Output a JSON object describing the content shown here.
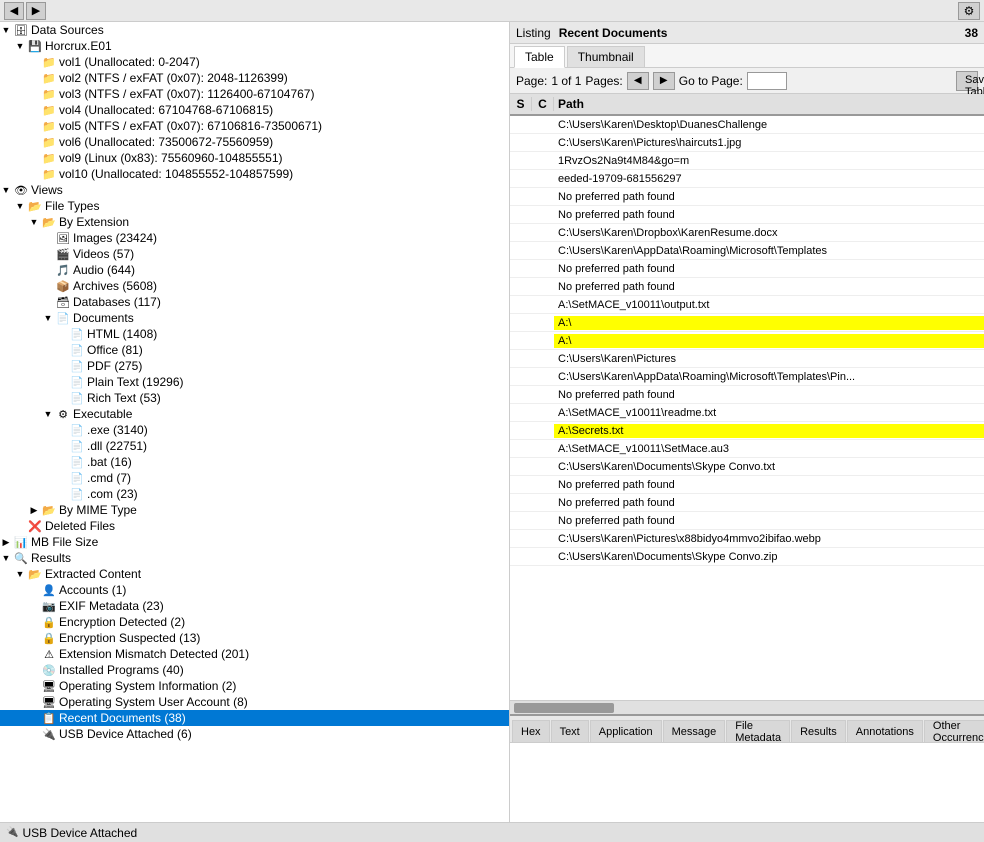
{
  "topBar": {
    "backLabel": "◀",
    "forwardLabel": "▶",
    "gearLabel": "⚙"
  },
  "leftPanel": {
    "tree": [
      {
        "id": "data-sources",
        "label": "Data Sources",
        "indent": 0,
        "expander": "▼",
        "icon": "🗄",
        "type": "root"
      },
      {
        "id": "horcrux",
        "label": "Horcrux.E01",
        "indent": 1,
        "expander": "▼",
        "icon": "💾",
        "type": "drive"
      },
      {
        "id": "vol1",
        "label": "vol1 (Unallocated: 0-2047)",
        "indent": 2,
        "expander": " ",
        "icon": "📁",
        "type": "vol"
      },
      {
        "id": "vol2",
        "label": "vol2 (NTFS / exFAT (0x07): 2048-1126399)",
        "indent": 2,
        "expander": " ",
        "icon": "📁",
        "type": "vol"
      },
      {
        "id": "vol3",
        "label": "vol3 (NTFS / exFAT (0x07): 1126400-67104767)",
        "indent": 2,
        "expander": " ",
        "icon": "📁",
        "type": "vol"
      },
      {
        "id": "vol4",
        "label": "vol4 (Unallocated: 67104768-67106815)",
        "indent": 2,
        "expander": " ",
        "icon": "📁",
        "type": "vol"
      },
      {
        "id": "vol5",
        "label": "vol5 (NTFS / exFAT (0x07): 67106816-73500671)",
        "indent": 2,
        "expander": " ",
        "icon": "📁",
        "type": "vol"
      },
      {
        "id": "vol6",
        "label": "vol6 (Unallocated: 73500672-75560959)",
        "indent": 2,
        "expander": " ",
        "icon": "📁",
        "type": "vol"
      },
      {
        "id": "vol9",
        "label": "vol9 (Linux (0x83): 75560960-104855551)",
        "indent": 2,
        "expander": " ",
        "icon": "📁",
        "type": "vol"
      },
      {
        "id": "vol10",
        "label": "vol10 (Unallocated: 104855552-104857599)",
        "indent": 2,
        "expander": " ",
        "icon": "📁",
        "type": "vol"
      },
      {
        "id": "views",
        "label": "Views",
        "indent": 0,
        "expander": "▼",
        "icon": "👁",
        "type": "section"
      },
      {
        "id": "file-types",
        "label": "File Types",
        "indent": 1,
        "expander": "▼",
        "icon": "📂",
        "type": "folder"
      },
      {
        "id": "by-extension",
        "label": "By Extension",
        "indent": 2,
        "expander": "▼",
        "icon": "📂",
        "type": "folder"
      },
      {
        "id": "images",
        "label": "Images (23424)",
        "indent": 3,
        "expander": " ",
        "icon": "🖼",
        "type": "item"
      },
      {
        "id": "videos",
        "label": "Videos (57)",
        "indent": 3,
        "expander": " ",
        "icon": "🎬",
        "type": "item"
      },
      {
        "id": "audio",
        "label": "Audio (644)",
        "indent": 3,
        "expander": " ",
        "icon": "🎵",
        "type": "item"
      },
      {
        "id": "archives",
        "label": "Archives (5608)",
        "indent": 3,
        "expander": " ",
        "icon": "📦",
        "type": "item"
      },
      {
        "id": "databases",
        "label": "Databases (117)",
        "indent": 3,
        "expander": " ",
        "icon": "🗃",
        "type": "item"
      },
      {
        "id": "documents",
        "label": "Documents",
        "indent": 3,
        "expander": "▼",
        "icon": "📄",
        "type": "folder"
      },
      {
        "id": "html",
        "label": "HTML (1408)",
        "indent": 4,
        "expander": " ",
        "icon": "📄",
        "type": "item"
      },
      {
        "id": "office",
        "label": "Office (81)",
        "indent": 4,
        "expander": " ",
        "icon": "📄",
        "type": "item"
      },
      {
        "id": "pdf",
        "label": "PDF (275)",
        "indent": 4,
        "expander": " ",
        "icon": "📄",
        "type": "item"
      },
      {
        "id": "plaintext",
        "label": "Plain Text (19296)",
        "indent": 4,
        "expander": " ",
        "icon": "📄",
        "type": "item"
      },
      {
        "id": "richtext",
        "label": "Rich Text (53)",
        "indent": 4,
        "expander": " ",
        "icon": "📄",
        "type": "item"
      },
      {
        "id": "executable",
        "label": "Executable",
        "indent": 3,
        "expander": "▼",
        "icon": "⚙",
        "type": "folder"
      },
      {
        "id": "exe",
        "label": ".exe (3140)",
        "indent": 4,
        "expander": " ",
        "icon": "📄",
        "type": "item"
      },
      {
        "id": "dll",
        "label": ".dll (22751)",
        "indent": 4,
        "expander": " ",
        "icon": "📄",
        "type": "item"
      },
      {
        "id": "bat",
        "label": ".bat (16)",
        "indent": 4,
        "expander": " ",
        "icon": "📄",
        "type": "item"
      },
      {
        "id": "cmd",
        "label": ".cmd (7)",
        "indent": 4,
        "expander": " ",
        "icon": "📄",
        "type": "item"
      },
      {
        "id": "com",
        "label": ".com (23)",
        "indent": 4,
        "expander": " ",
        "icon": "📄",
        "type": "item"
      },
      {
        "id": "by-mime",
        "label": "By MIME Type",
        "indent": 2,
        "expander": "▶",
        "icon": "📂",
        "type": "folder"
      },
      {
        "id": "deleted",
        "label": "Deleted Files",
        "indent": 1,
        "expander": " ",
        "icon": "❌",
        "type": "item"
      },
      {
        "id": "mb-filesize",
        "label": "MB File Size",
        "indent": 0,
        "expander": "▶",
        "icon": "📊",
        "type": "section"
      },
      {
        "id": "results",
        "label": "Results",
        "indent": 0,
        "expander": "▼",
        "icon": "🔍",
        "type": "section"
      },
      {
        "id": "extracted-content",
        "label": "Extracted Content",
        "indent": 1,
        "expander": "▼",
        "icon": "📂",
        "type": "folder"
      },
      {
        "id": "accounts",
        "label": "Accounts (1)",
        "indent": 2,
        "expander": " ",
        "icon": "👤",
        "type": "item"
      },
      {
        "id": "exif-metadata",
        "label": "EXIF Metadata (23)",
        "indent": 2,
        "expander": " ",
        "icon": "📷",
        "type": "item"
      },
      {
        "id": "encryption-detected",
        "label": "Encryption Detected (2)",
        "indent": 2,
        "expander": " ",
        "icon": "🔒",
        "type": "item"
      },
      {
        "id": "encryption-suspected",
        "label": "Encryption Suspected (13)",
        "indent": 2,
        "expander": " ",
        "icon": "🔒",
        "type": "item"
      },
      {
        "id": "extension-mismatch",
        "label": "Extension Mismatch Detected (201)",
        "indent": 2,
        "expander": " ",
        "icon": "⚠",
        "type": "item"
      },
      {
        "id": "installed-programs",
        "label": "Installed Programs (40)",
        "indent": 2,
        "expander": " ",
        "icon": "💿",
        "type": "item"
      },
      {
        "id": "os-info",
        "label": "Operating System Information (2)",
        "indent": 2,
        "expander": " ",
        "icon": "🖥",
        "type": "item"
      },
      {
        "id": "os-user-account",
        "label": "Operating System User Account (8)",
        "indent": 2,
        "expander": " ",
        "icon": "🖥",
        "type": "item"
      },
      {
        "id": "recent-docs",
        "label": "Recent Documents (38)",
        "indent": 2,
        "expander": " ",
        "icon": "📋",
        "type": "item",
        "selected": true
      },
      {
        "id": "usb-device",
        "label": "USB Device Attached (6)",
        "indent": 2,
        "expander": " ",
        "icon": "🔌",
        "type": "item"
      }
    ]
  },
  "rightPanel": {
    "listing": "Listing",
    "sectionTitle": "Recent Documents",
    "rowCount": "38",
    "tabs": [
      {
        "id": "table",
        "label": "Table",
        "active": true
      },
      {
        "id": "thumbnail",
        "label": "Thumbnail",
        "active": false
      }
    ],
    "pagination": {
      "pageLabel": "Page:",
      "pageValue": "1 of 1",
      "pagesLabel": "Pages:",
      "gotoLabel": "Go to Page:",
      "saveLabel": "Save Table as"
    },
    "tableHeaders": {
      "s": "S",
      "c": "C",
      "path": "Path"
    },
    "rows": [
      {
        "s": "",
        "c": "",
        "path": "C:\\Users\\Karen\\Desktop\\DuanesChallenge",
        "highlight": false
      },
      {
        "s": "",
        "c": "",
        "path": "C:\\Users\\Karen\\Pictures\\haircuts1.jpg",
        "highlight": false
      },
      {
        "s": "",
        "c": "",
        "path": "1RvzOs2Na9t4M84&go=m",
        "highlight": false
      },
      {
        "s": "",
        "c": "",
        "path": "eeded-19709-681556297",
        "highlight": false
      },
      {
        "s": "",
        "c": "",
        "path": "No preferred path found",
        "highlight": false
      },
      {
        "s": "",
        "c": "",
        "path": "No preferred path found",
        "highlight": false
      },
      {
        "s": "",
        "c": "",
        "path": "C:\\Users\\Karen\\Dropbox\\KarenResume.docx",
        "highlight": false
      },
      {
        "s": "",
        "c": "",
        "path": "C:\\Users\\Karen\\AppData\\Roaming\\Microsoft\\Templates",
        "highlight": false
      },
      {
        "s": "",
        "c": "",
        "path": "No preferred path found",
        "highlight": false
      },
      {
        "s": "",
        "c": "",
        "path": "No preferred path found",
        "highlight": false
      },
      {
        "s": "",
        "c": "",
        "path": "A:\\SetMACE_v10011\\output.txt",
        "highlight": false
      },
      {
        "s": "",
        "c": "",
        "path": "A:\\",
        "highlight": true
      },
      {
        "s": "",
        "c": "",
        "path": "A:\\",
        "highlight": true
      },
      {
        "s": "",
        "c": "",
        "path": "C:\\Users\\Karen\\Pictures",
        "highlight": false
      },
      {
        "s": "",
        "c": "",
        "path": "C:\\Users\\Karen\\AppData\\Roaming\\Microsoft\\Templates\\Pin...",
        "highlight": false
      },
      {
        "s": "",
        "c": "",
        "path": "No preferred path found",
        "highlight": false
      },
      {
        "s": "",
        "c": "",
        "path": "A:\\SetMACE_v10011\\readme.txt",
        "highlight": false
      },
      {
        "s": "",
        "c": "",
        "path": "A:\\Secrets.txt",
        "highlight": true
      },
      {
        "s": "",
        "c": "",
        "path": "A:\\SetMACE_v10011\\SetMace.au3",
        "highlight": false
      },
      {
        "s": "",
        "c": "",
        "path": "C:\\Users\\Karen\\Documents\\Skype Convo.txt",
        "highlight": false
      },
      {
        "s": "",
        "c": "",
        "path": "No preferred path found",
        "highlight": false
      },
      {
        "s": "",
        "c": "",
        "path": "No preferred path found",
        "highlight": false
      },
      {
        "s": "",
        "c": "",
        "path": "No preferred path found",
        "highlight": false
      },
      {
        "s": "",
        "c": "",
        "path": "C:\\Users\\Karen\\Pictures\\x88bidyo4mmvo2ibifao.webp",
        "highlight": false
      },
      {
        "s": "",
        "c": "",
        "path": "C:\\Users\\Karen\\Documents\\Skype Convo.zip",
        "highlight": false
      }
    ],
    "bottomTabs": [
      {
        "id": "hex",
        "label": "Hex",
        "active": false
      },
      {
        "id": "text",
        "label": "Text",
        "active": false
      },
      {
        "id": "application",
        "label": "Application",
        "active": false
      },
      {
        "id": "message",
        "label": "Message",
        "active": false
      },
      {
        "id": "file-metadata",
        "label": "File Metadata",
        "active": false
      },
      {
        "id": "results",
        "label": "Results",
        "active": false
      },
      {
        "id": "annotations",
        "label": "Annotations",
        "active": false
      },
      {
        "id": "other-occurrences",
        "label": "Other Occurrences",
        "active": false
      }
    ]
  },
  "statusBar": {
    "usbLabel": "USB Device Attached"
  }
}
